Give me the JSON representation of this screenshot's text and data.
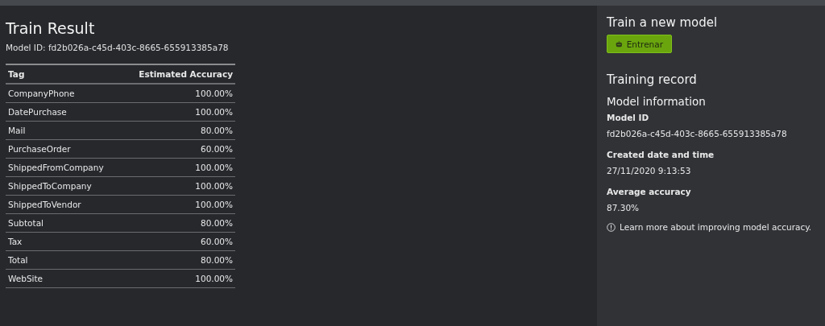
{
  "title": "Train Result",
  "model_id_line": "Model ID: fd2b026a-c45d-403c-8665-655913385a78",
  "table": {
    "columns": [
      "Tag",
      "Estimated Accuracy"
    ],
    "rows": [
      {
        "tag": "CompanyPhone",
        "accuracy": "100.00%"
      },
      {
        "tag": "DatePurchase",
        "accuracy": "100.00%"
      },
      {
        "tag": "Mail",
        "accuracy": "80.00%"
      },
      {
        "tag": "PurchaseOrder",
        "accuracy": "60.00%"
      },
      {
        "tag": "ShippedFromCompany",
        "accuracy": "100.00%"
      },
      {
        "tag": "ShippedToCompany",
        "accuracy": "100.00%"
      },
      {
        "tag": "ShippedToVendor",
        "accuracy": "100.00%"
      },
      {
        "tag": "Subtotal",
        "accuracy": "80.00%"
      },
      {
        "tag": "Tax",
        "accuracy": "60.00%"
      },
      {
        "tag": "Total",
        "accuracy": "80.00%"
      },
      {
        "tag": "WebSite",
        "accuracy": "100.00%"
      }
    ]
  },
  "sidebar": {
    "train_heading": "Train a new model",
    "train_button": "Entrenar",
    "record_heading": "Training record",
    "info_heading": "Model information",
    "fields": [
      {
        "label": "Model ID",
        "value": "fd2b026a-c45d-403c-8665-655913385a78"
      },
      {
        "label": "Created date and time",
        "value": "27/11/2020 9:13:53"
      },
      {
        "label": "Average accuracy",
        "value": "87.30%"
      }
    ],
    "learn_more": "Learn more about improving model accuracy."
  }
}
